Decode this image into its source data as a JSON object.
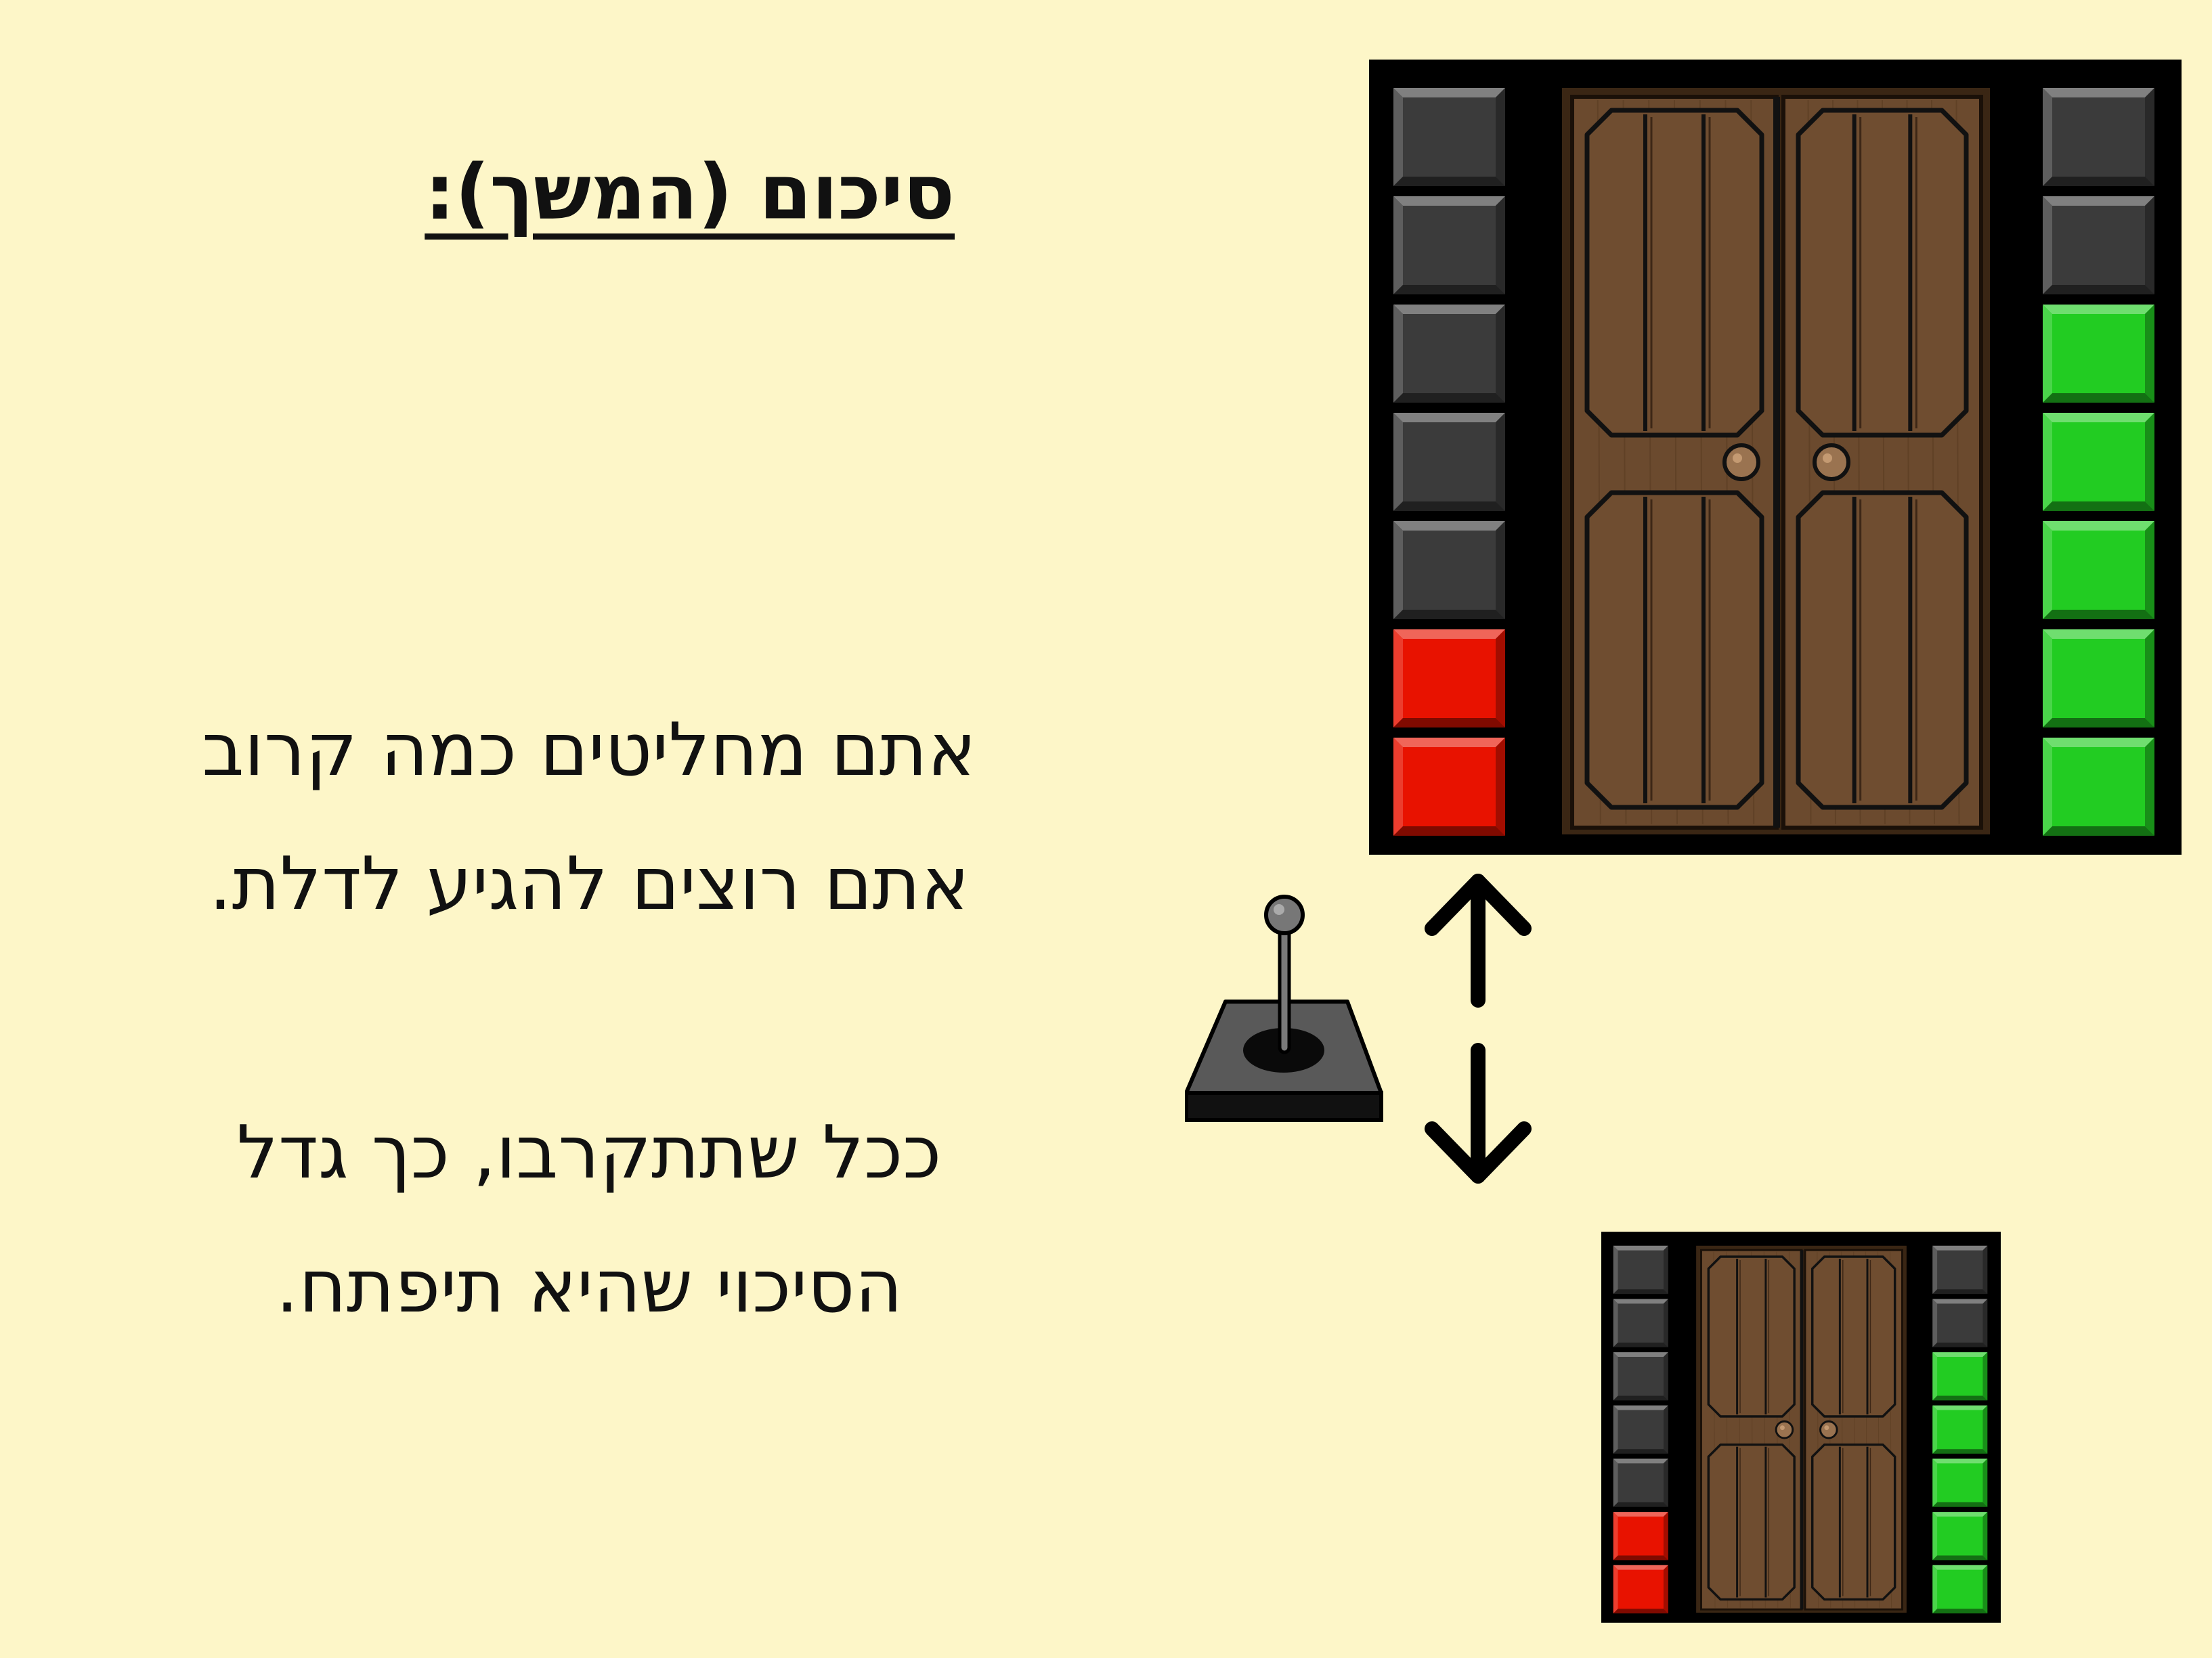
{
  "slide": {
    "title": "סיכום (המשך):",
    "paragraphs": [
      {
        "lines": [
          "אתם מחליטים כמה קרוב",
          "אתם רוצים להגיע לדלת."
        ]
      },
      {
        "lines": [
          "ככל שתתקרבו, כך גדל",
          "הסיכוי שהיא תיפתח."
        ]
      }
    ]
  },
  "icons": {
    "near_door": "double-door-with-indicator-lights-icon",
    "far_door": "double-door-with-indicator-lights-icon",
    "joystick": "joystick-icon",
    "arrow_up": "arrow-up-icon",
    "arrow_down": "arrow-down-icon"
  },
  "door_indicators": {
    "left_column": [
      "off",
      "off",
      "off",
      "off",
      "off",
      "red",
      "red"
    ],
    "right_column": [
      "off",
      "off",
      "green",
      "green",
      "green",
      "green",
      "green"
    ]
  },
  "colors": {
    "background": "#fdf6c8",
    "door_wood": "#6b4a2e",
    "light_off": "#3b3b3b",
    "light_red": "#e81200",
    "light_green": "#22cc22"
  }
}
